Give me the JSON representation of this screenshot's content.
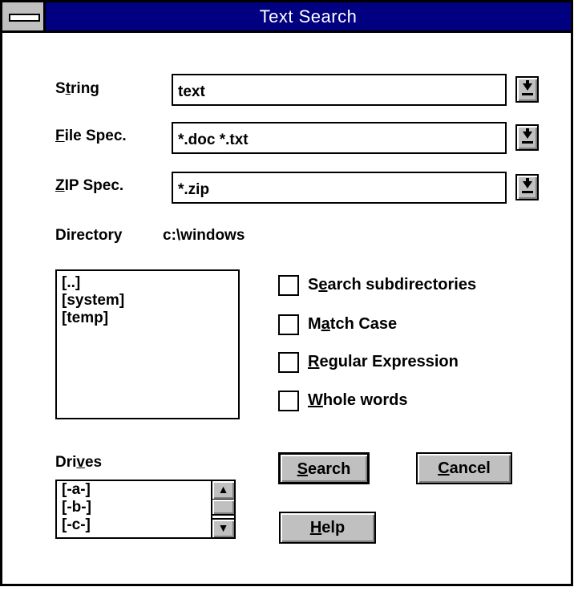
{
  "window": {
    "title": "Text Search"
  },
  "fields": {
    "string": {
      "label_pre": "S",
      "label_u": "t",
      "label_post": "ring",
      "value": "text"
    },
    "filespec": {
      "label_pre": "",
      "label_u": "F",
      "label_post": "ile Spec.",
      "value": "*.doc *.txt"
    },
    "zipspec": {
      "label_pre": "",
      "label_u": "Z",
      "label_post": "IP Spec.",
      "value": "*.zip"
    }
  },
  "directory": {
    "label": "Directory",
    "value": "c:\\windows"
  },
  "dir_list": [
    "[..]",
    "[system]",
    "[temp]"
  ],
  "options": [
    {
      "pre": "S",
      "u": "e",
      "post": "arch subdirectories",
      "checked": false
    },
    {
      "pre": "M",
      "u": "a",
      "post": "tch Case",
      "checked": false
    },
    {
      "pre": "",
      "u": "R",
      "post": "egular Expression",
      "checked": false
    },
    {
      "pre": "",
      "u": "W",
      "post": "hole words",
      "checked": false
    }
  ],
  "drives": {
    "label_pre": "Dri",
    "label_u": "v",
    "label_post": "es",
    "items": [
      "[-a-]",
      "[-b-]",
      "[-c-]"
    ]
  },
  "buttons": {
    "search": {
      "u": "S",
      "post": "earch"
    },
    "cancel": {
      "u": "C",
      "post": "ancel"
    },
    "help": {
      "u": "H",
      "post": "elp"
    }
  },
  "colors": {
    "titlebar": "#000080",
    "face": "#c0c0c0"
  }
}
